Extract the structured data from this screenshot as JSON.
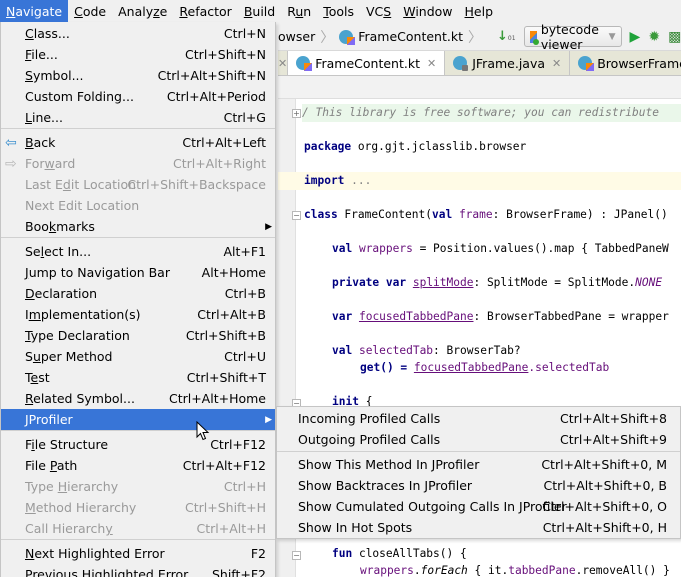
{
  "menubar": {
    "items": [
      {
        "label": "Navigate",
        "mnemonic_index": 0,
        "active": true
      },
      {
        "label": "Code",
        "mnemonic_index": 0
      },
      {
        "label": "Analyze",
        "mnemonic_index": 5
      },
      {
        "label": "Refactor",
        "mnemonic_index": 0
      },
      {
        "label": "Build",
        "mnemonic_index": 0
      },
      {
        "label": "Run",
        "mnemonic_index": 1
      },
      {
        "label": "Tools",
        "mnemonic_index": 0
      },
      {
        "label": "VCS",
        "mnemonic_index": 2
      },
      {
        "label": "Window",
        "mnemonic_index": 0
      },
      {
        "label": "Help",
        "mnemonic_index": 0
      }
    ]
  },
  "navbar": {
    "crumb_prev": "owser",
    "crumb_file": "FrameContent.kt",
    "sort_icon": "sort-bytecode-icon",
    "run_config": "bytecode viewer",
    "buttons": [
      "run-icon",
      "debug-icon",
      "profile-icon"
    ]
  },
  "tabs": [
    {
      "label": "FrameContent.kt",
      "active": true,
      "icon": "kotlin-file-icon"
    },
    {
      "label": "JFrame.java",
      "active": false,
      "icon": "java-class-locked-icon"
    },
    {
      "label": "BrowserFrame.kt",
      "active": false,
      "icon": "kotlin-file-icon"
    }
  ],
  "editor": {
    "lines": {
      "comment": "/ This library is free software; you can redistribute",
      "package_kw": "package",
      "package_name": " org.gjt.jclasslib.browser",
      "import_kw": "import",
      "import_rest": " ...",
      "class_kw": "class",
      "class_rest_a": " FrameContent(",
      "class_val": "val",
      "class_frame": " frame",
      "class_rest_b": ": BrowserFrame) : JPanel()",
      "wrappers_val": "val",
      "wrappers_name": " wrappers",
      "wrappers_rest": " = Position.values().map { TabbedPaneW",
      "split_private": "private var",
      "split_name": "splitMode",
      "split_rest": ": SplitMode = SplitMode.",
      "split_none": "NONE",
      "focused_var": "var",
      "focused_name": "focusedTabbedPane",
      "focused_rest": ": BrowserTabbedPane = wrapper",
      "selected_val": "val",
      "selected_name": " selectedTab",
      "selected_rest": ": BrowserTab?",
      "getter_a": "get() = ",
      "getter_b": "focusedTabbedPane",
      "getter_c": ".selectedTab",
      "init_kw": "init",
      "init_rest": " {",
      "fun_kw": "fun",
      "fun_rest": " closeAllTabs() {",
      "foreach_a": "wrappers",
      "foreach_b": ".",
      "foreach_c": "forEach",
      "foreach_d": " { it.",
      "foreach_e": "tabbedPane",
      "foreach_f": ".removeAll() }"
    }
  },
  "navigate_menu": {
    "items": [
      {
        "label": "Class...",
        "shortcut": "Ctrl+N"
      },
      {
        "label": "File...",
        "shortcut": "Ctrl+Shift+N"
      },
      {
        "label": "Symbol...",
        "shortcut": "Ctrl+Alt+Shift+N"
      },
      {
        "label": "Custom Folding...",
        "shortcut": "Ctrl+Alt+Period"
      },
      {
        "label": "Line...",
        "shortcut": "Ctrl+G"
      },
      {
        "label": "Back",
        "shortcut": "Ctrl+Alt+Left",
        "icon": "back-arrow-icon"
      },
      {
        "label": "Forward",
        "shortcut": "Ctrl+Alt+Right",
        "icon": "forward-arrow-icon",
        "disabled": true
      },
      {
        "label": "Last Edit Location",
        "shortcut": "Ctrl+Shift+Backspace",
        "disabled": true
      },
      {
        "label": "Next Edit Location",
        "shortcut": "",
        "disabled": true
      },
      {
        "label": "Bookmarks",
        "shortcut": "",
        "submenu": true
      },
      {
        "label": "Select In...",
        "shortcut": "Alt+F1"
      },
      {
        "label": "Jump to Navigation Bar",
        "shortcut": "Alt+Home"
      },
      {
        "label": "Declaration",
        "shortcut": "Ctrl+B"
      },
      {
        "label": "Implementation(s)",
        "shortcut": "Ctrl+Alt+B"
      },
      {
        "label": "Type Declaration",
        "shortcut": "Ctrl+Shift+B"
      },
      {
        "label": "Super Method",
        "shortcut": "Ctrl+U"
      },
      {
        "label": "Test",
        "shortcut": "Ctrl+Shift+T"
      },
      {
        "label": "Related Symbol...",
        "shortcut": "Ctrl+Alt+Home"
      },
      {
        "label": "JProfiler",
        "shortcut": "",
        "submenu": true,
        "selected": true
      },
      {
        "label": "File Structure",
        "shortcut": "Ctrl+F12"
      },
      {
        "label": "File Path",
        "shortcut": "Ctrl+Alt+F12"
      },
      {
        "label": "Type Hierarchy",
        "shortcut": "Ctrl+H",
        "disabled": true
      },
      {
        "label": "Method Hierarchy",
        "shortcut": "Ctrl+Shift+H",
        "disabled": true
      },
      {
        "label": "Call Hierarchy",
        "shortcut": "Ctrl+Alt+H",
        "disabled": true
      },
      {
        "label": "Next Highlighted Error",
        "shortcut": "F2"
      },
      {
        "label": "Previous Highlighted Error",
        "shortcut": "Shift+F2"
      }
    ]
  },
  "jprofiler_submenu": {
    "items": [
      {
        "label": "Incoming Profiled Calls",
        "shortcut": "Ctrl+Alt+Shift+8"
      },
      {
        "label": "Outgoing Profiled Calls",
        "shortcut": "Ctrl+Alt+Shift+9"
      },
      {
        "label": "Show This Method In JProfiler",
        "shortcut": "Ctrl+Alt+Shift+0, M"
      },
      {
        "label": "Show Backtraces In JProfiler",
        "shortcut": "Ctrl+Alt+Shift+0, B"
      },
      {
        "label": "Show Cumulated Outgoing Calls In JProfiler",
        "shortcut": "Ctrl+Alt+Shift+0, O"
      },
      {
        "label": "Show In Hot Spots",
        "shortcut": "Ctrl+Alt+Shift+0, H"
      }
    ]
  },
  "colors": {
    "selection": "#3875d7",
    "menu_bg": "#f0f0f0",
    "disabled_text": "#9a9a9a",
    "keyword": "#000080",
    "property": "#660e7a",
    "comment": "#808080"
  }
}
